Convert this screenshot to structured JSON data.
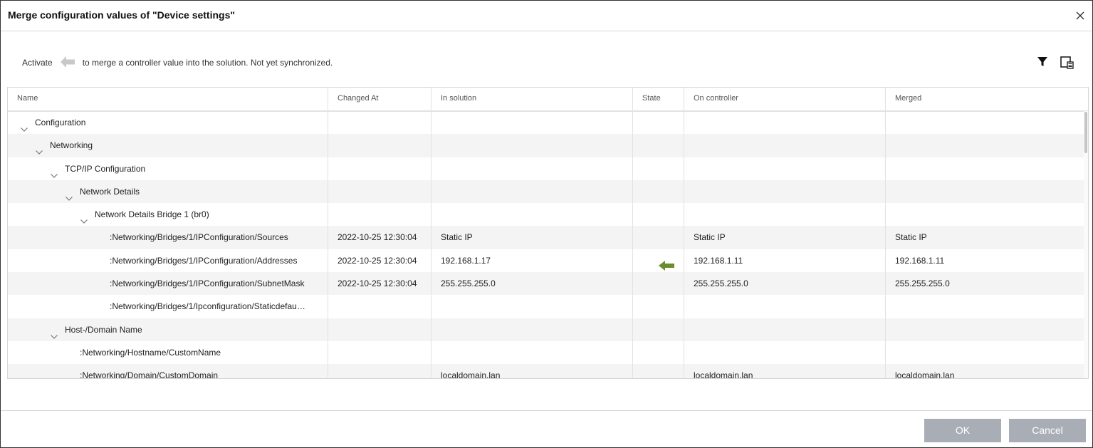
{
  "dialog": {
    "title": "Merge configuration values of \"Device settings\""
  },
  "hint": {
    "before": "Activate",
    "after": "to merge a controller value into the solution. Not yet synchronized."
  },
  "columns": [
    "Name",
    "Changed At",
    "In solution",
    "State",
    "On controller",
    "Merged"
  ],
  "rows": [
    {
      "name": "Configuration",
      "level": 0,
      "expandable": true,
      "changed": "",
      "solution": "",
      "state": "",
      "controller": "",
      "merged": ""
    },
    {
      "name": "Networking",
      "level": 1,
      "expandable": true,
      "changed": "",
      "solution": "",
      "state": "",
      "controller": "",
      "merged": ""
    },
    {
      "name": "TCP/IP Configuration",
      "level": 2,
      "expandable": true,
      "changed": "",
      "solution": "",
      "state": "",
      "controller": "",
      "merged": ""
    },
    {
      "name": "Network Details",
      "level": 3,
      "expandable": true,
      "changed": "",
      "solution": "",
      "state": "",
      "controller": "",
      "merged": ""
    },
    {
      "name": "Network Details Bridge 1 (br0)",
      "level": 4,
      "expandable": true,
      "changed": "",
      "solution": "",
      "state": "",
      "controller": "",
      "merged": ""
    },
    {
      "name": ":Networking/Bridges/1/IPConfiguration/Sources",
      "level": 6,
      "expandable": false,
      "changed": "2022-10-25 12:30:04",
      "solution": "Static IP",
      "state": "",
      "controller": "Static IP",
      "merged": "Static IP"
    },
    {
      "name": ":Networking/Bridges/1/IPConfiguration/Addresses",
      "level": 6,
      "expandable": false,
      "changed": "2022-10-25 12:30:04",
      "solution": "192.168.1.17",
      "state": "merge-arrow",
      "controller": "192.168.1.11",
      "merged": "192.168.1.11"
    },
    {
      "name": ":Networking/Bridges/1/IPConfiguration/SubnetMask",
      "level": 6,
      "expandable": false,
      "changed": "2022-10-25 12:30:04",
      "solution": "255.255.255.0",
      "state": "",
      "controller": "255.255.255.0",
      "merged": "255.255.255.0"
    },
    {
      "name": ":Networking/Bridges/1/Ipconfiguration/Staticdefau…",
      "level": 6,
      "expandable": false,
      "changed": "",
      "solution": "",
      "state": "",
      "controller": "",
      "merged": ""
    },
    {
      "name": "Host-/Domain Name",
      "level": 2,
      "expandable": true,
      "changed": "",
      "solution": "",
      "state": "",
      "controller": "",
      "merged": ""
    },
    {
      "name": ":Networking/Hostname/CustomName",
      "level": 4,
      "expandable": false,
      "changed": "",
      "solution": "",
      "state": "",
      "controller": "",
      "merged": ""
    },
    {
      "name": ":Networking/Domain/CustomDomain",
      "level": 4,
      "expandable": false,
      "changed": "",
      "solution": "localdomain.lan",
      "state": "",
      "controller": "localdomain.lan",
      "merged": "localdomain.lan"
    }
  ],
  "buttons": {
    "ok": "OK",
    "cancel": "Cancel"
  },
  "icons": {
    "close": "close-icon",
    "filter": "filter-icon",
    "columns": "column-chooser-icon",
    "hint_arrow": "arrow-left-icon",
    "merge_arrow": "merge-arrow-icon"
  },
  "colors": {
    "merge_arrow": "#6b8e2b",
    "hint_arrow": "#c8c8c8",
    "button_bg": "#a9aeb6",
    "alt_row": "#f4f4f4"
  }
}
